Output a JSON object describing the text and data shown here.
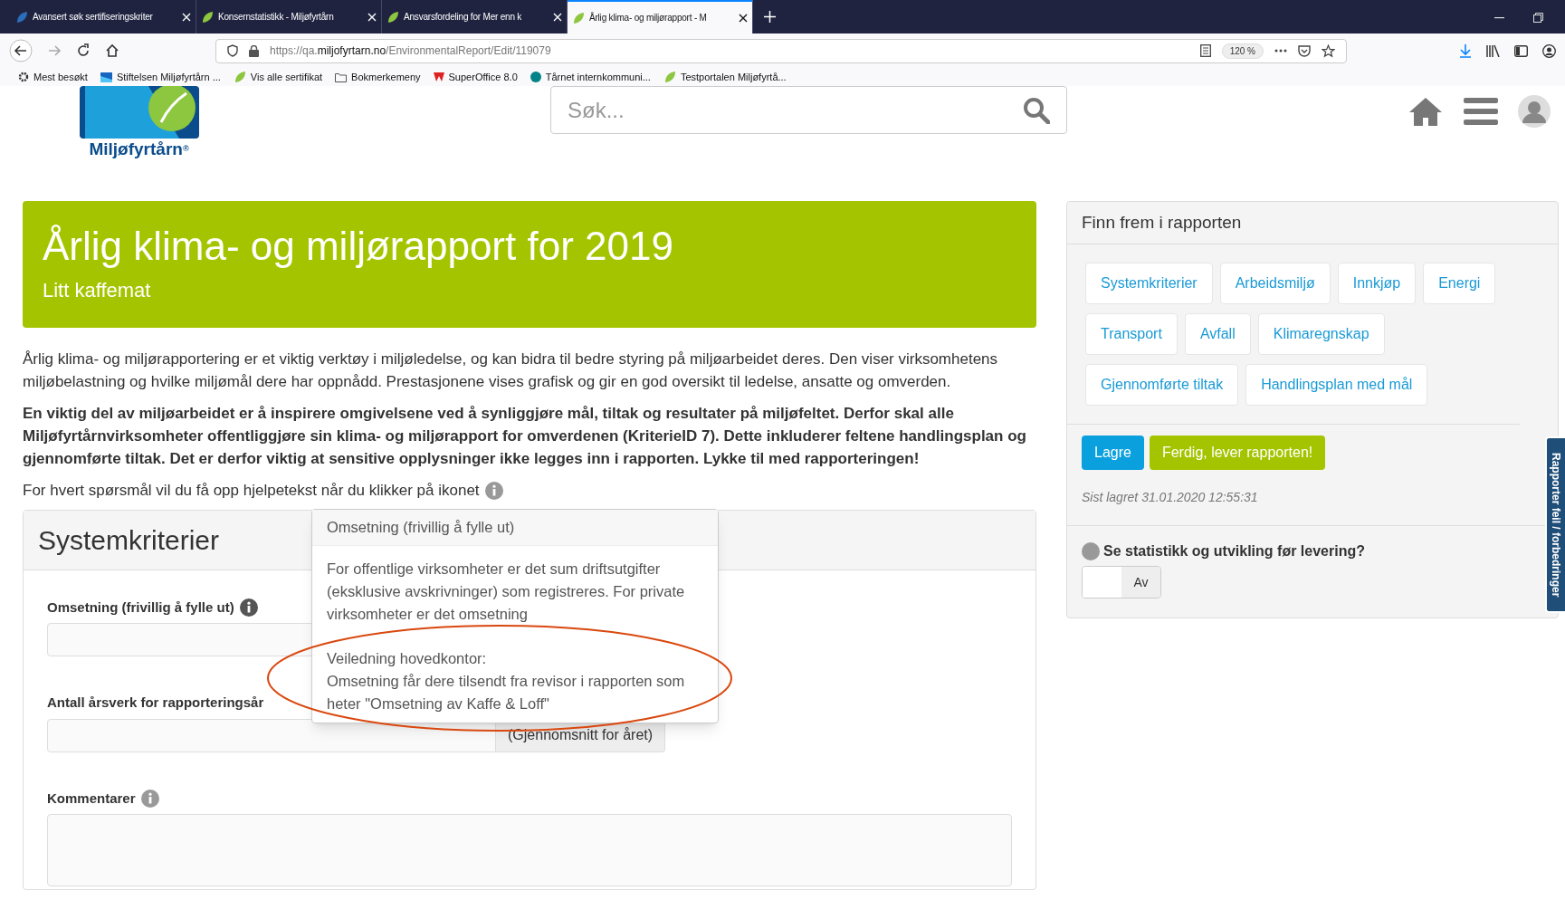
{
  "browser": {
    "tabs": [
      {
        "title": "Avansert søk sertifiseringskriter",
        "selected": false
      },
      {
        "title": "Konsernstatistikk - Miljøfyrtårn",
        "selected": false
      },
      {
        "title": "Ansvarsfordeling for Mer enn k",
        "selected": false
      },
      {
        "title": "Årlig klima- og miljørapport - M",
        "selected": true
      }
    ],
    "url_prefix": "https://qa.",
    "url_domain": "miljofyrtarn.no",
    "url_path": "/EnvironmentalReport/Edit/119079",
    "zoom": "120 %",
    "bookmarks": [
      "Mest besøkt",
      "Stiftelsen Miljøfyrtårn ...",
      "Vis alle sertifikat",
      "Bokmerkemeny",
      "SuperOffice 8.0",
      "Tårnet internkommuni...",
      "Testportalen Miljøfyrtå..."
    ]
  },
  "header": {
    "logo_text": "Miljøfyrtårn",
    "logo_mark": "®",
    "search_placeholder": "Søk..."
  },
  "banner": {
    "title": "Årlig klima- og miljørapport for 2019",
    "subtitle": "Litt kaffemat"
  },
  "intro": "Årlig klima- og miljørapportering er et viktig verktøy i miljøledelse, og kan bidra til bedre styring på miljøarbeidet deres. Den viser virksomhetens miljøbelastning og hvilke miljømål dere har oppnådd. Prestasjonene vises grafisk og gir en god oversikt til ledelse, ansatte og omverden.",
  "notice": "En viktig del av miljøarbeidet er å inspirere omgivelsene ved å synliggjøre mål, tiltak og resultater på miljøfeltet. Derfor skal alle Miljøfyrtårnvirksomheter offentliggjøre sin klima- og miljørapport for omverdenen (KriterieID 7). Dette inkluderer feltene handlingsplan og gjennomførte tiltak. Det er derfor viktig at sensitive opplysninger ikke legges inn i rapporten. Lykke til med rapporteringen!",
  "help_hint": "For hvert spørsmål vil du få opp hjelpetekst når du klikker på ikonet",
  "section": {
    "title": "Systemkriterier",
    "fields": [
      {
        "label": "Omsetning (frivillig å fylle ut)",
        "kind": "text"
      },
      {
        "label": "Antall årsverk for rapporteringsår",
        "kind": "addon",
        "addon": "(Gjennomsnitt for året)"
      },
      {
        "label": "Kommentarer",
        "kind": "textarea"
      }
    ]
  },
  "tooltip": {
    "title": "Omsetning (frivillig å fylle ut)",
    "body": "For offentlige virksomheter er det sum driftsutgifter (eksklusive avskrivninger) som registreres. For private virksomheter er det omsetning",
    "guidance_title": "Veiledning hovedkontor:",
    "guidance": "Omsetning får dere tilsendt fra revisor i rapporten som heter \"Omsetning av Kaffe & Loff\""
  },
  "sidebar": {
    "title": "Finn frem i rapporten",
    "links": [
      "Systemkriterier",
      "Arbeidsmiljø",
      "Innkjøp",
      "Energi",
      "Transport",
      "Avfall",
      "Klimaregnskap",
      "Gjennomførte tiltak",
      "Handlingsplan med mål"
    ],
    "save": "Lagre",
    "submit": "Ferdig, lever rapporten!",
    "last_saved": "Sist lagret 31.01.2020 12:55:31",
    "stats_question": "Se statistikk og utvikling før levering?",
    "toggle": {
      "label": "Av",
      "on": false
    }
  },
  "feedback_tab": "Rapporter feil / forbedringer"
}
